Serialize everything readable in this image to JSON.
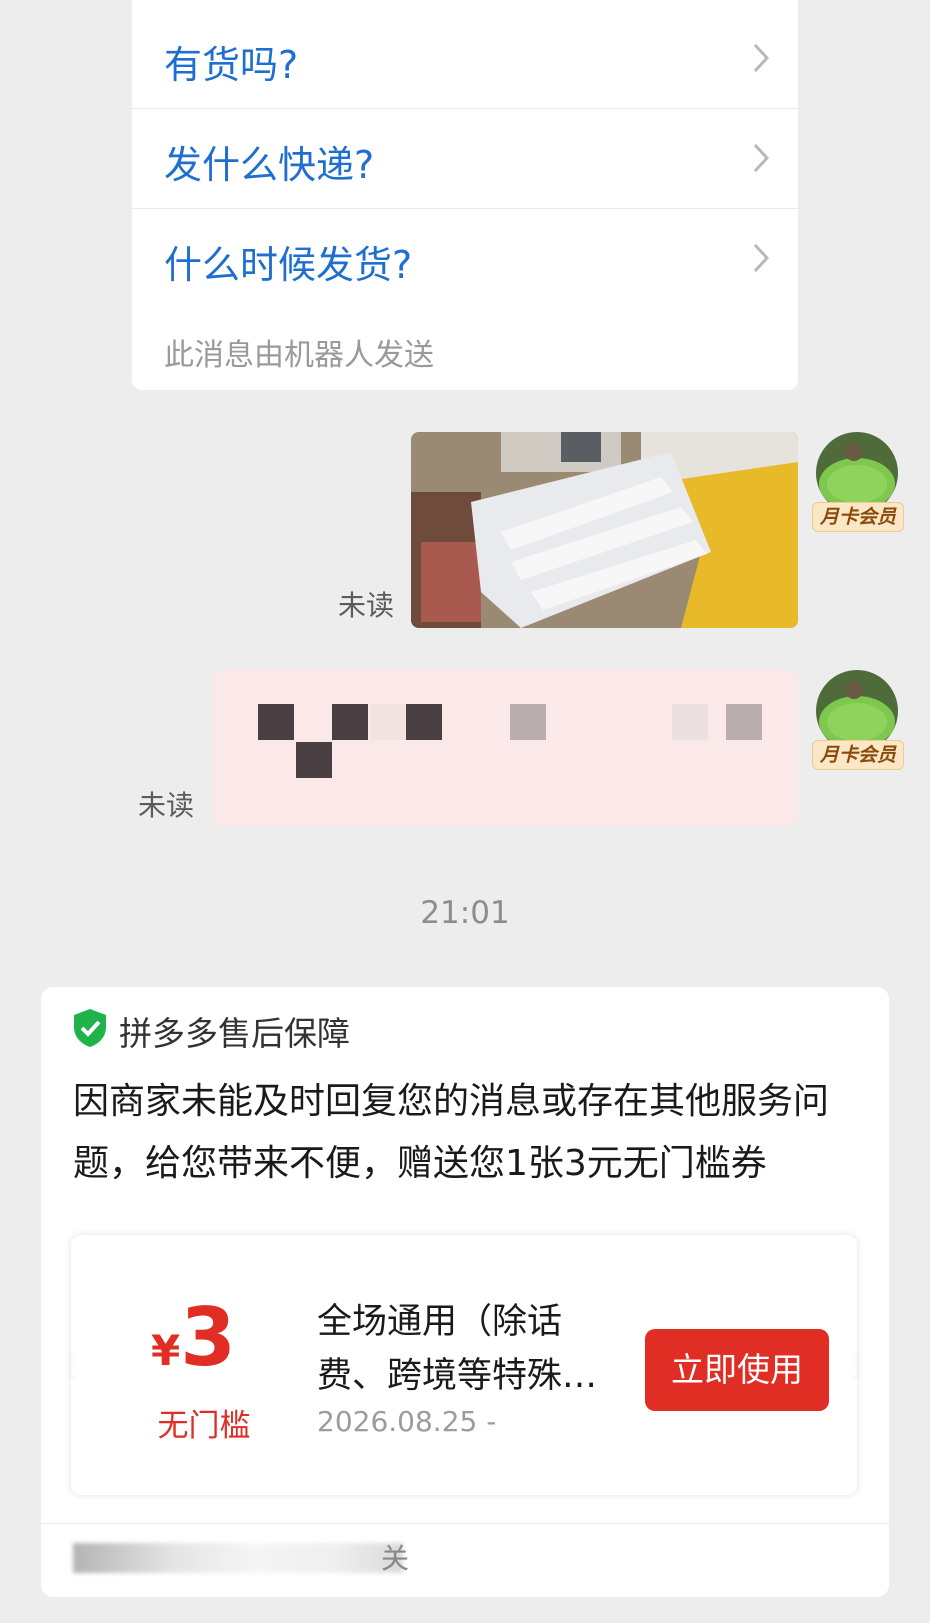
{
  "bot_card": {
    "questions": [
      "有货吗?",
      "发什么快递?",
      "什么时候发货?"
    ],
    "note": "此消息由机器人发送"
  },
  "messages": [
    {
      "type": "image",
      "status": "未读",
      "member_badge": "月卡会员"
    },
    {
      "type": "text",
      "status": "未读",
      "member_badge": "月卡会员"
    }
  ],
  "timestamp": "21:01",
  "after_sales": {
    "title": "拼多多售后保障",
    "body": "因商家未能及时回复您的消息或存在其他服务问题，给您带来不便，赠送您1张3元无门槛券",
    "coupon": {
      "currency": "¥",
      "amount": "3",
      "condition": "无门槛",
      "description": "全场通用（除话费、跨境等特殊…",
      "valid_date": "2026.08.25 -",
      "button_label": "立即使用"
    },
    "footer_text_end": "关"
  },
  "colors": {
    "link_blue": "#1e6fd0",
    "brand_red": "#e02e24",
    "shield_green": "#1fb34a",
    "unread_bubble": "#fbe9e9"
  }
}
